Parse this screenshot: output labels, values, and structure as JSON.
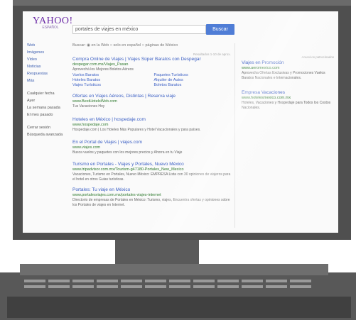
{
  "logo": {
    "text": "YAHOO!",
    "sub": "ESPAÑOL"
  },
  "search": {
    "query": "portales de viajes en méxico",
    "button": "Buscar"
  },
  "filters": "Buscar: ◉ en la Web  ○ solo en español  ○ páginas de México",
  "top_note": "Resultados 1-10 de aprox.",
  "sidebar": {
    "group1": [
      "Web",
      "Imágenes",
      "Video",
      "Noticias",
      "Respuestas",
      "Más"
    ],
    "group2": [
      "Cualquier fecha",
      "Ayer",
      "La semana pasada",
      "El mes pasado"
    ],
    "group3": [
      "Cerrar sesión",
      "Búsqueda avanzada"
    ]
  },
  "results": [
    {
      "title": "Compra Online de Viajes | Viajes Súper Baratos con Despegar",
      "url": "despegar.com.mx/Viajes_Pasan",
      "desc": "Aprovechá los Mejores Boletos Aéreos",
      "sublinks": [
        "Vuelos Baratos",
        "Paquetes Turísticos",
        "Hoteles Baratos",
        "Alquiler de Autos",
        "Viajes Turísticos",
        "Boletos Baratos"
      ]
    },
    {
      "title": "Ofertas en Viajes Aéreos, Distintas | Reserva viaje",
      "url": "www.BestHotelsWeb.com",
      "desc": "Tus Vacaciones Hoy"
    },
    {
      "title": "Hoteles en México | hospedaje.com",
      "url": "www.hospedaje.com",
      "desc": "Hospedaje.com | Los Hoteles Más Populares y Hotel Vacacionales y para países."
    },
    {
      "title": "En el Portal de Viajes | viajes.com",
      "url": "www.viajes.com",
      "desc": "Busca vuelos y paquetes con los mejores precios y Ahorra en tu Viaje"
    },
    {
      "title": "Turismo en Portales - Viajes y Portales, Nuevo México",
      "url": "www.tripadvisor.com.mx/Tourism-g47180-Portales_New_Mexico",
      "desc": "Vacaciones, Turismo en Portales, Nuevo México: EMPRESA Lista con 30 opiniones de viajeros para el hotel en otros Guias turísticas."
    },
    {
      "title": "Portales: Tu viaje en México",
      "url": "www.portalesviajes.com.mx/portales-viajes-internet",
      "desc": "Directorio de empresas de Portales en México: Turismo, viajes, Encuentra ofertas y opiniones sobre los Portales de viajes en Internet."
    }
  ],
  "right": {
    "header": "Anuncios patrocinados",
    "ads": [
      {
        "title": "Viajes en Promoción",
        "url": "www.aeromexico.com",
        "desc": "Aprovecha Ofertas Exclusivas y Promociones Vuelos Baratos Nacionales e Internacionales."
      },
      {
        "title": "Empresa Vacaciones",
        "url": "www.hotelesmexico.com.mx",
        "desc": "Hoteles, Vacaciones y Hospedaje para Todos los Costos Nacionales."
      }
    ]
  }
}
